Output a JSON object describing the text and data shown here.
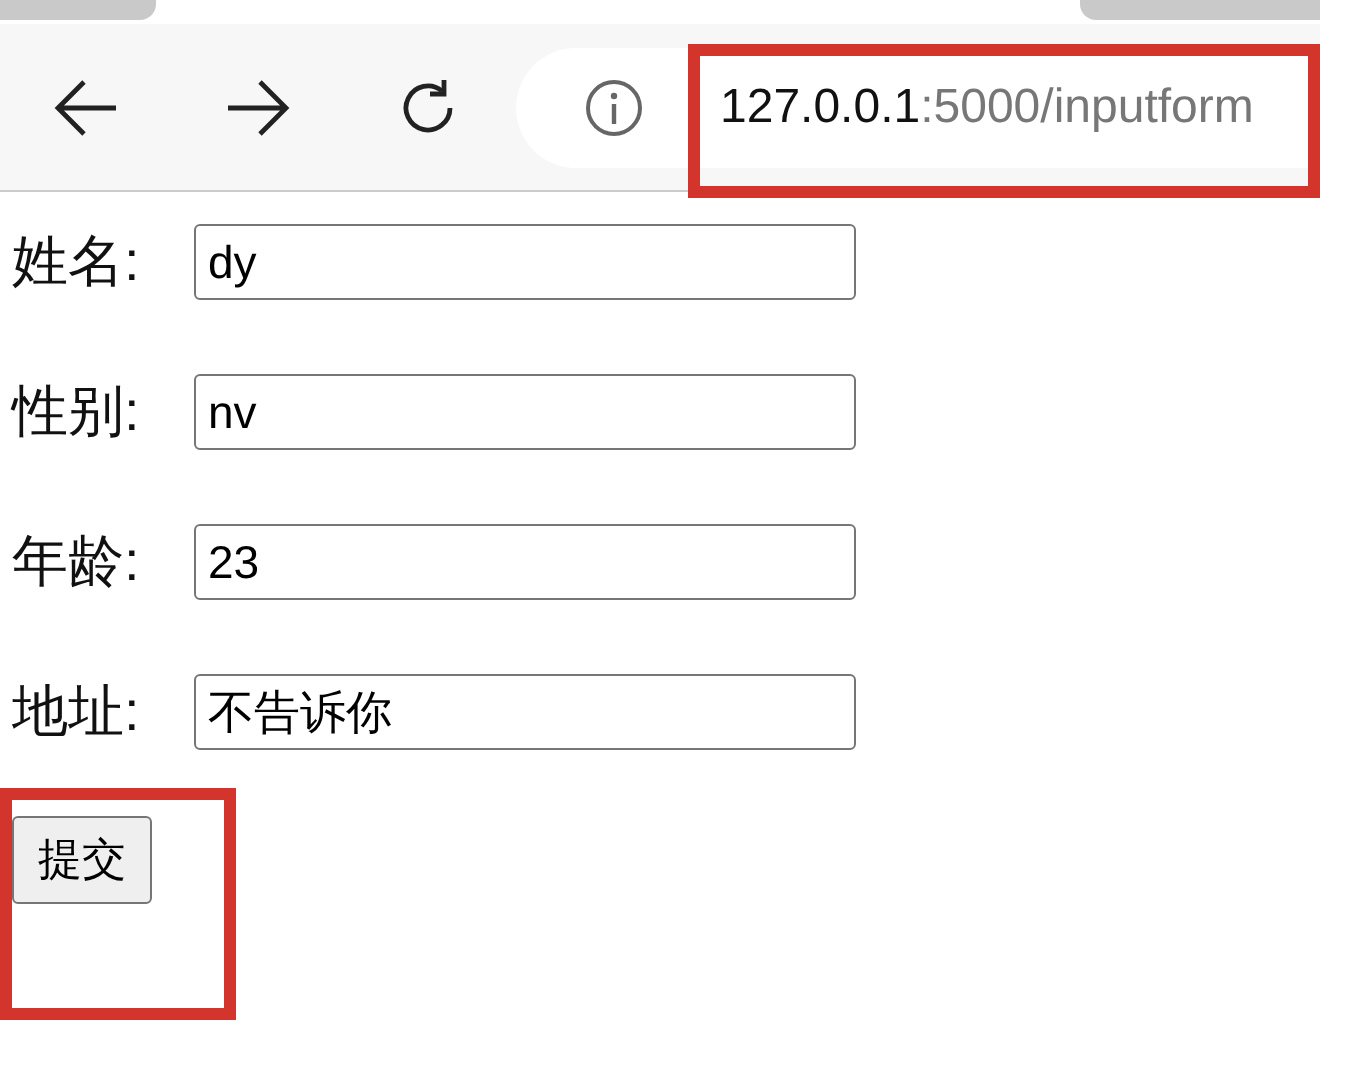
{
  "browser": {
    "url_host": "127.0.0.1",
    "url_path": ":5000/inputform"
  },
  "form": {
    "fields": [
      {
        "label": "姓名:",
        "value": "dy"
      },
      {
        "label": "性别:",
        "value": "nv"
      },
      {
        "label": "年龄:",
        "value": "23"
      },
      {
        "label": "地址:",
        "value": "不告诉你"
      }
    ],
    "submit": "提交"
  }
}
